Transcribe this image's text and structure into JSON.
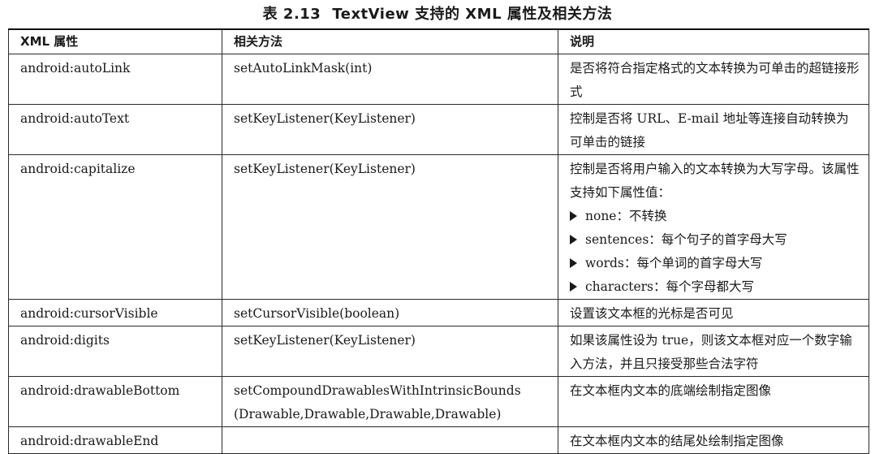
{
  "caption": {
    "number": "表 2.13",
    "title": "TextView 支持的 XML 属性及相关方法"
  },
  "table": {
    "headers": [
      "XML 属性",
      "相关方法",
      "说明"
    ],
    "rows": [
      {
        "attribute": "android:autoLink",
        "method": "setAutoLinkMask(int)",
        "description": "是否将符合指定格式的文本转换为可单击的超链接形式"
      },
      {
        "attribute": "android:autoText",
        "method": "setKeyListener(KeyListener)",
        "description": "控制是否将 URL、E-mail 地址等连接自动转换为可单击的链接"
      },
      {
        "attribute": "android:capitalize",
        "method": "setKeyListener(KeyListener)",
        "description": "控制是否将用户输入的文本转换为大写字母。该属性支持如下属性值：",
        "options": [
          "none：不转换",
          "sentences：每个句子的首字母大写",
          "words：每个单词的首字母大写",
          "characters：每个字母都大写"
        ]
      },
      {
        "attribute": "android:cursorVisible",
        "method": "setCursorVisible(boolean)",
        "description": "设置该文本框的光标是否可见"
      },
      {
        "attribute": "android:digits",
        "method": "setKeyListener(KeyListener)",
        "description": "如果该属性设为 true，则该文本框对应一个数字输入方法，并且只接受那些合法字符"
      },
      {
        "attribute": "android:drawableBottom",
        "method": "setCompoundDrawablesWithIntrinsicBounds (Drawable,Drawable,Drawable,Drawable)",
        "description": "在文本框内文本的底端绘制指定图像"
      },
      {
        "attribute": "android:drawableEnd",
        "method": "",
        "description": "在文本框内文本的结尾处绘制指定图像"
      }
    ]
  }
}
